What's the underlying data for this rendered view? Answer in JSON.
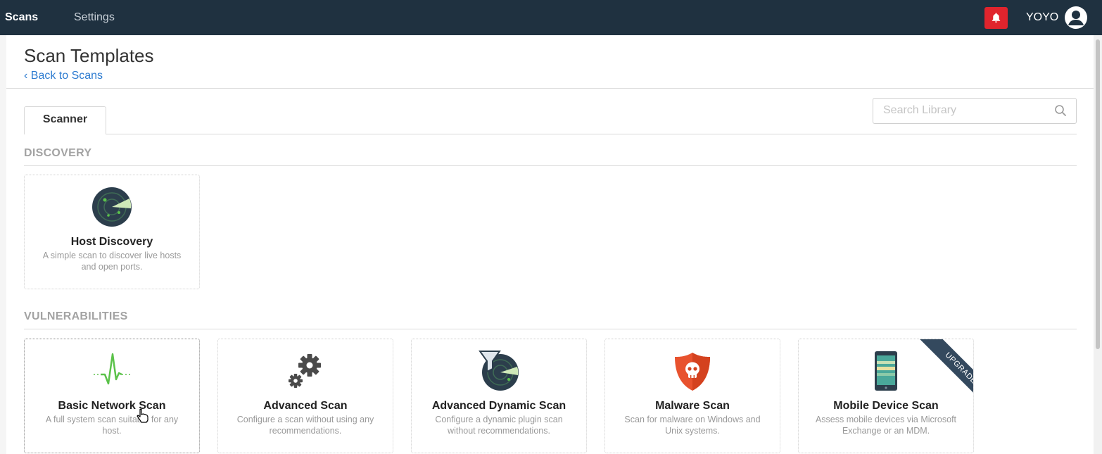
{
  "topbar": {
    "nav_scans": "Scans",
    "nav_settings": "Settings",
    "username": "YOYO",
    "notification_icon": "bell-icon",
    "avatar_icon": "user-icon",
    "notification_color": "#e0242d",
    "bar_color": "#1f3140"
  },
  "header": {
    "title": "Scan Templates",
    "back_link": "‹ Back to Scans"
  },
  "tabs": [
    {
      "label": "Scanner",
      "active": true
    }
  ],
  "search": {
    "placeholder": "Search Library",
    "value": "",
    "icon": "search-icon"
  },
  "sections": [
    {
      "label": "DISCOVERY",
      "cards": [
        {
          "title": "Host Discovery",
          "desc": "A simple scan to discover live hosts and open ports.",
          "icon": "radar-icon"
        }
      ]
    },
    {
      "label": "VULNERABILITIES",
      "cards": [
        {
          "title": "Basic Network Scan",
          "desc": "A full system scan suitable for any host.",
          "icon": "pulse-icon"
        },
        {
          "title": "Advanced Scan",
          "desc": "Configure a scan without using any recommendations.",
          "icon": "gears-icon"
        },
        {
          "title": "Advanced Dynamic Scan",
          "desc": "Configure a dynamic plugin scan without recommendations.",
          "icon": "filter-radar-icon"
        },
        {
          "title": "Malware Scan",
          "desc": "Scan for malware on Windows and Unix systems.",
          "icon": "skull-shield-icon"
        },
        {
          "title": "Mobile Device Scan",
          "desc": "Assess mobile devices via Microsoft Exchange or an MDM.",
          "icon": "mobile-device-icon",
          "badge": "UPGRADE"
        }
      ]
    }
  ]
}
